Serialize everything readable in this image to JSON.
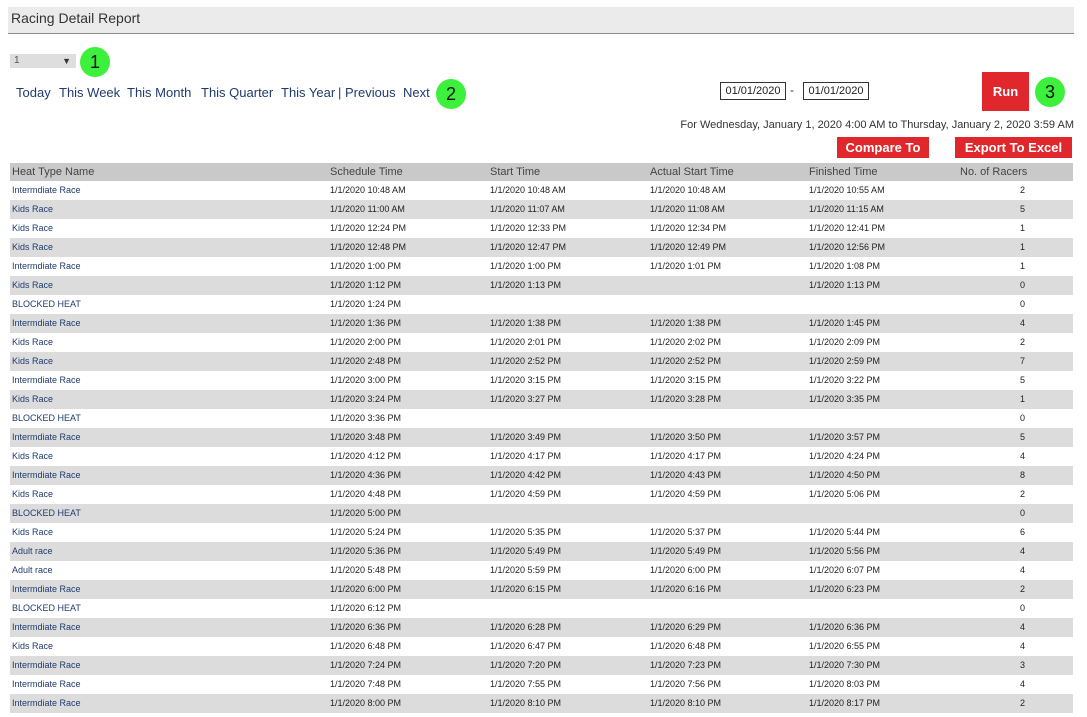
{
  "header": {
    "title": "Racing Detail Report"
  },
  "selector": {
    "value": "1"
  },
  "badges": [
    "1",
    "2",
    "3"
  ],
  "periods": [
    "Today",
    "This Week",
    "This Month",
    "This Quarter",
    "This Year",
    "| Previous",
    "Next"
  ],
  "date_range": {
    "from": "01/01/2020",
    "separator": "-",
    "to": "01/01/2020"
  },
  "run_label": "Run",
  "range_text": "For Wednesday, January 1, 2020 4:00 AM to Thursday, January 2, 2020 3:59 AM",
  "actions": {
    "compare_label": "Compare To",
    "export_label": "Export To Excel"
  },
  "colors": {
    "accent_red": "#e0282c",
    "badge_green": "#3cf03c",
    "header_gray": "#c9c9c9",
    "row_stripe": "#dcdcdc"
  },
  "table": {
    "columns": [
      "Heat Type Name",
      "Schedule Time",
      "Start Time",
      "Actual Start Time",
      "Finished Time",
      "No. of Racers"
    ],
    "rows": [
      [
        "Intermdiate Race",
        "1/1/2020 10:48 AM",
        "1/1/2020 10:48 AM",
        "1/1/2020 10:48 AM",
        "1/1/2020 10:55 AM",
        "2"
      ],
      [
        "Kids Race",
        "1/1/2020 11:00 AM",
        "1/1/2020 11:07 AM",
        "1/1/2020 11:08 AM",
        "1/1/2020 11:15 AM",
        "5"
      ],
      [
        "Kids Race",
        "1/1/2020 12:24 PM",
        "1/1/2020 12:33 PM",
        "1/1/2020 12:34 PM",
        "1/1/2020 12:41 PM",
        "1"
      ],
      [
        "Kids Race",
        "1/1/2020 12:48 PM",
        "1/1/2020 12:47 PM",
        "1/1/2020 12:49 PM",
        "1/1/2020 12:56 PM",
        "1"
      ],
      [
        "Intermdiate Race",
        "1/1/2020 1:00 PM",
        "1/1/2020 1:00 PM",
        "1/1/2020 1:01 PM",
        "1/1/2020 1:08 PM",
        "1"
      ],
      [
        "Kids Race",
        "1/1/2020 1:12 PM",
        "1/1/2020 1:13 PM",
        "",
        "1/1/2020 1:13 PM",
        "0"
      ],
      [
        "BLOCKED HEAT",
        "1/1/2020 1:24 PM",
        "",
        "",
        "",
        "0"
      ],
      [
        "Intermdiate Race",
        "1/1/2020 1:36 PM",
        "1/1/2020 1:38 PM",
        "1/1/2020 1:38 PM",
        "1/1/2020 1:45 PM",
        "4"
      ],
      [
        "Kids Race",
        "1/1/2020 2:00 PM",
        "1/1/2020 2:01 PM",
        "1/1/2020 2:02 PM",
        "1/1/2020 2:09 PM",
        "2"
      ],
      [
        "Kids Race",
        "1/1/2020 2:48 PM",
        "1/1/2020 2:52 PM",
        "1/1/2020 2:52 PM",
        "1/1/2020 2:59 PM",
        "7"
      ],
      [
        "Intermdiate Race",
        "1/1/2020 3:00 PM",
        "1/1/2020 3:15 PM",
        "1/1/2020 3:15 PM",
        "1/1/2020 3:22 PM",
        "5"
      ],
      [
        "Kids Race",
        "1/1/2020 3:24 PM",
        "1/1/2020 3:27 PM",
        "1/1/2020 3:28 PM",
        "1/1/2020 3:35 PM",
        "1"
      ],
      [
        "BLOCKED HEAT",
        "1/1/2020 3:36 PM",
        "",
        "",
        "",
        "0"
      ],
      [
        "Intermdiate Race",
        "1/1/2020 3:48 PM",
        "1/1/2020 3:49 PM",
        "1/1/2020 3:50 PM",
        "1/1/2020 3:57 PM",
        "5"
      ],
      [
        "Kids Race",
        "1/1/2020 4:12 PM",
        "1/1/2020 4:17 PM",
        "1/1/2020 4:17 PM",
        "1/1/2020 4:24 PM",
        "4"
      ],
      [
        "Intermdiate Race",
        "1/1/2020 4:36 PM",
        "1/1/2020 4:42 PM",
        "1/1/2020 4:43 PM",
        "1/1/2020 4:50 PM",
        "8"
      ],
      [
        "Kids Race",
        "1/1/2020 4:48 PM",
        "1/1/2020 4:59 PM",
        "1/1/2020 4:59 PM",
        "1/1/2020 5:06 PM",
        "2"
      ],
      [
        "BLOCKED HEAT",
        "1/1/2020 5:00 PM",
        "",
        "",
        "",
        "0"
      ],
      [
        "Kids Race",
        "1/1/2020 5:24 PM",
        "1/1/2020 5:35 PM",
        "1/1/2020 5:37 PM",
        "1/1/2020 5:44 PM",
        "6"
      ],
      [
        "Adult race",
        "1/1/2020 5:36 PM",
        "1/1/2020 5:49 PM",
        "1/1/2020 5:49 PM",
        "1/1/2020 5:56 PM",
        "4"
      ],
      [
        "Adult race",
        "1/1/2020 5:48 PM",
        "1/1/2020 5:59 PM",
        "1/1/2020 6:00 PM",
        "1/1/2020 6:07 PM",
        "4"
      ],
      [
        "Intermdiate Race",
        "1/1/2020 6:00 PM",
        "1/1/2020 6:15 PM",
        "1/1/2020 6:16 PM",
        "1/1/2020 6:23 PM",
        "2"
      ],
      [
        "BLOCKED HEAT",
        "1/1/2020 6:12 PM",
        "",
        "",
        "",
        "0"
      ],
      [
        "Intermdiate Race",
        "1/1/2020 6:36 PM",
        "1/1/2020 6:28 PM",
        "1/1/2020 6:29 PM",
        "1/1/2020 6:36 PM",
        "4"
      ],
      [
        "Kids Race",
        "1/1/2020 6:48 PM",
        "1/1/2020 6:47 PM",
        "1/1/2020 6:48 PM",
        "1/1/2020 6:55 PM",
        "4"
      ],
      [
        "Intermdiate Race",
        "1/1/2020 7:24 PM",
        "1/1/2020 7:20 PM",
        "1/1/2020 7:23 PM",
        "1/1/2020 7:30 PM",
        "3"
      ],
      [
        "Intermdiate Race",
        "1/1/2020 7:48 PM",
        "1/1/2020 7:55 PM",
        "1/1/2020 7:56 PM",
        "1/1/2020 8:03 PM",
        "4"
      ],
      [
        "Intermdiate Race",
        "1/1/2020 8:00 PM",
        "1/1/2020 8:10 PM",
        "1/1/2020 8:10 PM",
        "1/1/2020 8:17 PM",
        "2"
      ]
    ]
  }
}
